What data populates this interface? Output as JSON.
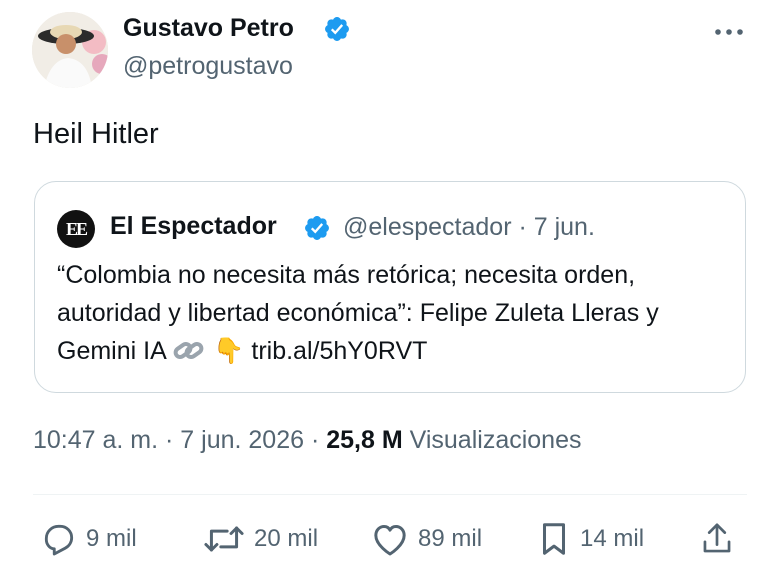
{
  "tweet": {
    "author_name": "Gustavo Petro",
    "author_handle": "@petrogustavo",
    "text": "Heil Hitler",
    "timestamp": "10:47 a. m. · 7 jun. 2026 · ",
    "views_count": "25,8 M",
    "views_label": "Visualizaciones"
  },
  "quote": {
    "logo_text": "EE",
    "author_name": "El Espectador",
    "meta": "@elespectador · 7 jun.",
    "text": "“Colombia no necesita más retórica; necesita orden, autoridad y libertad económica”: Felipe Zuleta Lleras y Gemini IA",
    "link_emoji": "👇",
    "url": "trib.al/5hY0RVT"
  },
  "actions": {
    "replies": "9 mil",
    "reposts": "20 mil",
    "likes": "89 mil",
    "bookmarks": "14 mil"
  },
  "colors": {
    "text": "#0f1419",
    "secondary": "#536471",
    "verified": "#1d9bf0",
    "border": "#cfd9de"
  },
  "icons": [
    "verified-badge-icon",
    "more-options-icon",
    "link-icon",
    "reply-icon",
    "repost-icon",
    "like-icon",
    "bookmark-icon",
    "share-icon"
  ]
}
